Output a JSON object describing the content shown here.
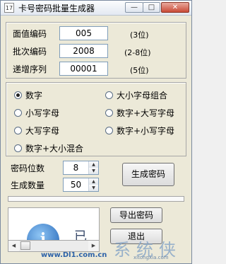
{
  "window": {
    "title": "卡号密码批量生成器",
    "icon_text": "17",
    "controls": {
      "minimize": "—",
      "maximize": "□",
      "close": "✕"
    }
  },
  "fields": [
    {
      "label": "面值编码",
      "value": "005",
      "hint": "(3位)"
    },
    {
      "label": "批次编码",
      "value": "2008",
      "hint": "(2-8位)"
    },
    {
      "label": "递增序列",
      "value": "00001",
      "hint": "(5位)"
    }
  ],
  "charset_options": [
    {
      "label": "数字",
      "checked": true
    },
    {
      "label": "大小字母组合",
      "checked": false
    },
    {
      "label": "小写字母",
      "checked": false
    },
    {
      "label": "数字+大写字母",
      "checked": false
    },
    {
      "label": "大写字母",
      "checked": false
    },
    {
      "label": "数字+小写字母",
      "checked": false
    },
    {
      "label": "数字+大小混合",
      "checked": false
    }
  ],
  "password_length": {
    "label": "密码位数",
    "value": "8"
  },
  "generate_count": {
    "label": "生成数量",
    "value": "50"
  },
  "buttons": {
    "generate": "生成密码",
    "export": "导出密码",
    "exit": "退出"
  },
  "progress": {
    "fraction": 0.0
  },
  "preview": {
    "glyph": "已"
  },
  "icons": {
    "info": "info-icon",
    "spin_up": "▲",
    "spin_down": "▼",
    "scroll_left": "◀",
    "scroll_right": "▶"
  },
  "watermark": {
    "url": "www.Dl1.com.cn",
    "logo": "系统侠",
    "sub": "xitongxia.com"
  },
  "colors": {
    "accent": "#3c9bd6",
    "window_bg": "#ece9d8"
  }
}
